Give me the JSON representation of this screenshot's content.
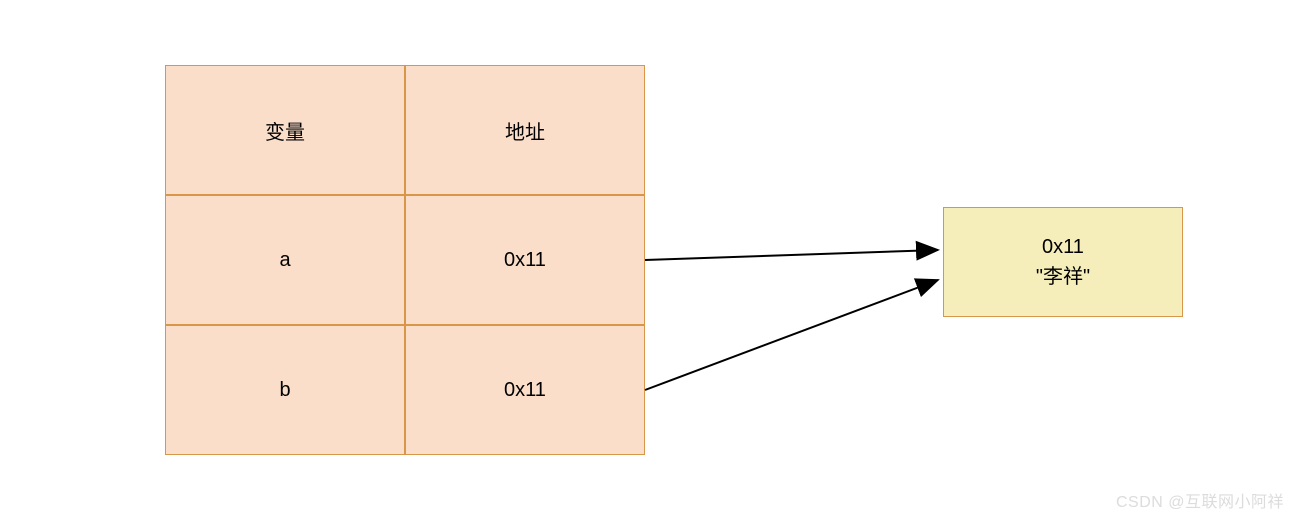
{
  "table": {
    "header": {
      "col1": "变量",
      "col2": "地址"
    },
    "rows": [
      {
        "variable": "a",
        "address": "0x11"
      },
      {
        "variable": "b",
        "address": "0x11"
      }
    ]
  },
  "memory": {
    "address": "0x11",
    "value": "\"李祥\""
  },
  "watermark": "CSDN @互联网小阿祥"
}
